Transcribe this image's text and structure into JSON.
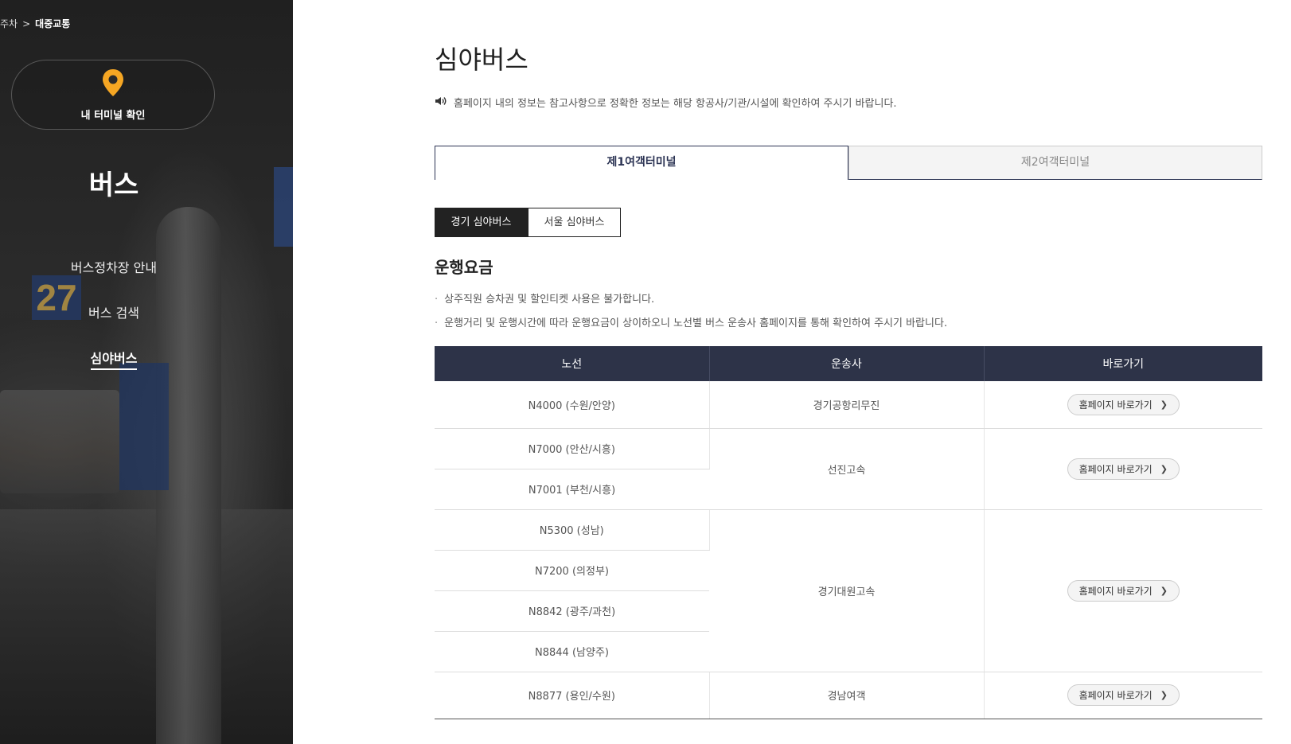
{
  "breadcrumb": {
    "parent": "주차",
    "separator": ">",
    "current": "대중교통"
  },
  "sidebar": {
    "terminal_button": "내 터미널 확인",
    "title": "버스",
    "items": [
      {
        "label": "버스정차장 안내"
      },
      {
        "label": "버스 검색"
      },
      {
        "label": "심야버스"
      }
    ]
  },
  "main": {
    "title": "심야버스",
    "notice": "홈페이지 내의 정보는 참고사항으로 정확한 정보는 해당 항공사/기관/시설에 확인하여 주시기 바랍니다.",
    "tabs": [
      {
        "label": "제1여객터미널"
      },
      {
        "label": "제2여객터미널"
      }
    ],
    "subtabs": [
      {
        "label": "경기 심야버스"
      },
      {
        "label": "서울 심야버스"
      }
    ],
    "section_title": "운행요금",
    "bullets": [
      "상주직원 승차권 및 할인티켓 사용은 불가합니다.",
      "운행거리 및 운행시간에 따라 운행요금이 상이하오니 노선별 버스 운송사 홈페이지를 통해 확인하여 주시기 바랍니다."
    ],
    "table": {
      "headers": [
        "노선",
        "운송사",
        "바로가기"
      ],
      "groups": [
        {
          "operator": "경기공항리무진",
          "routes": [
            "N4000 (수원/안양)"
          ],
          "button": "홈페이지 바로가기"
        },
        {
          "operator": "선진고속",
          "routes": [
            "N7000 (안산/시흥)",
            "N7001 (부천/시흥)"
          ],
          "button": "홈페이지 바로가기"
        },
        {
          "operator": "경기대원고속",
          "routes": [
            "N5300 (성남)",
            "N7200 (의정부)",
            "N8842 (광주/과천)",
            "N8844 (남양주)"
          ],
          "button": "홈페이지 바로가기"
        },
        {
          "operator": "경남여객",
          "routes": [
            "N8877 (용인/수원)"
          ],
          "button": "홈페이지 바로가기"
        }
      ]
    }
  },
  "icons": {
    "terminal_pin": "map-pin-icon",
    "notice": "speaker-icon",
    "chevron": "chevron-right-icon"
  },
  "colors": {
    "accent_orange": "#f5a623",
    "table_header": "#2d3348",
    "tab_active": "#2c3454"
  }
}
